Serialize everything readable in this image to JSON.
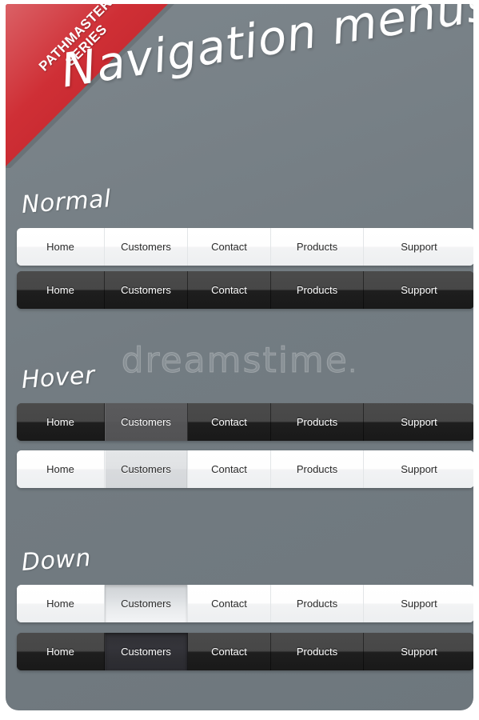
{
  "ribbon": {
    "line1": "PATHMASTER",
    "line2": "SERIES",
    "color": "#cc2229"
  },
  "hero": {
    "title": "Navigation menus"
  },
  "watermark": {
    "text": "dreamstime"
  },
  "background": {
    "color": "#747d83"
  },
  "sections": [
    {
      "label": "Normal",
      "bars": [
        {
          "theme": "light",
          "items": [
            {
              "label": "Home",
              "state": "normal"
            },
            {
              "label": "Customers",
              "state": "normal"
            },
            {
              "label": "Contact",
              "state": "normal"
            },
            {
              "label": "Products",
              "state": "normal"
            },
            {
              "label": "Support",
              "state": "normal"
            }
          ]
        },
        {
          "theme": "dark",
          "items": [
            {
              "label": "Home",
              "state": "normal"
            },
            {
              "label": "Customers",
              "state": "normal"
            },
            {
              "label": "Contact",
              "state": "normal"
            },
            {
              "label": "Products",
              "state": "normal"
            },
            {
              "label": "Support",
              "state": "normal"
            }
          ]
        }
      ]
    },
    {
      "label": "Hover",
      "bars": [
        {
          "theme": "dark",
          "items": [
            {
              "label": "Home",
              "state": "normal"
            },
            {
              "label": "Customers",
              "state": "hover"
            },
            {
              "label": "Contact",
              "state": "normal"
            },
            {
              "label": "Products",
              "state": "normal"
            },
            {
              "label": "Support",
              "state": "normal"
            }
          ]
        },
        {
          "theme": "light",
          "items": [
            {
              "label": "Home",
              "state": "normal"
            },
            {
              "label": "Customers",
              "state": "hover"
            },
            {
              "label": "Contact",
              "state": "normal"
            },
            {
              "label": "Products",
              "state": "normal"
            },
            {
              "label": "Support",
              "state": "normal"
            }
          ]
        }
      ]
    },
    {
      "label": "Down",
      "bars": [
        {
          "theme": "light",
          "items": [
            {
              "label": "Home",
              "state": "normal"
            },
            {
              "label": "Customers",
              "state": "down"
            },
            {
              "label": "Contact",
              "state": "normal"
            },
            {
              "label": "Products",
              "state": "normal"
            },
            {
              "label": "Support",
              "state": "normal"
            }
          ]
        },
        {
          "theme": "dark",
          "items": [
            {
              "label": "Home",
              "state": "normal"
            },
            {
              "label": "Customers",
              "state": "down"
            },
            {
              "label": "Contact",
              "state": "normal"
            },
            {
              "label": "Products",
              "state": "normal"
            },
            {
              "label": "Support",
              "state": "normal"
            }
          ]
        }
      ]
    }
  ]
}
